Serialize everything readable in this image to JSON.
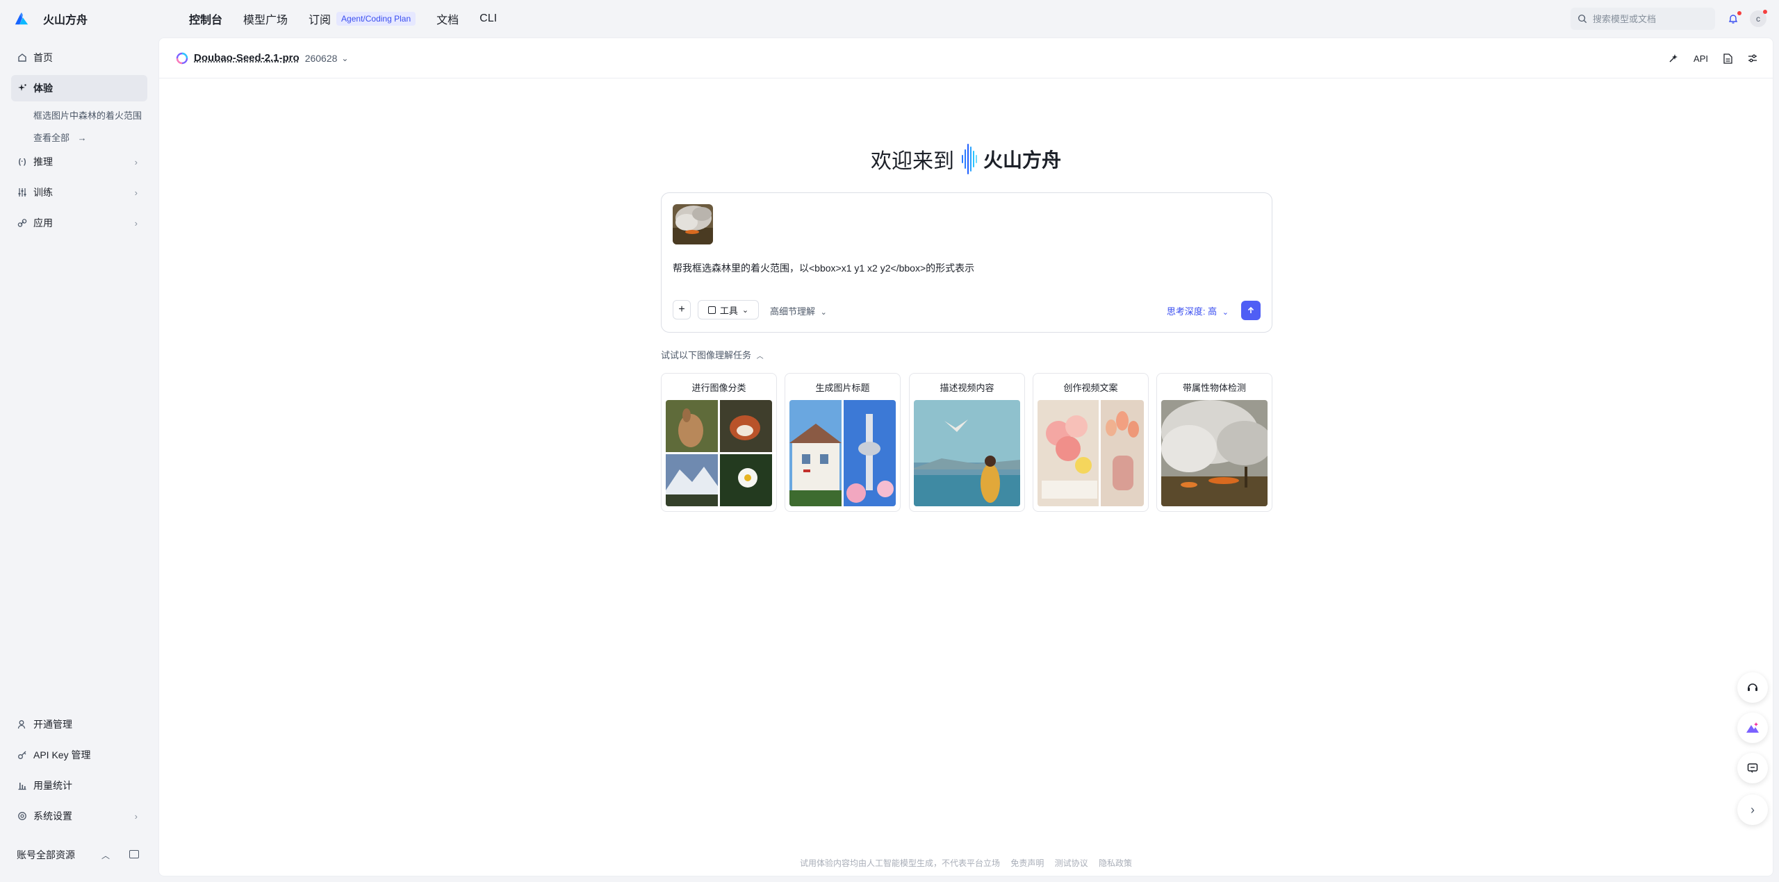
{
  "brand": {
    "name": "火山方舟"
  },
  "topnav": [
    {
      "label": "控制台"
    },
    {
      "label": "模型广场"
    },
    {
      "label": "订阅",
      "badge": "Agent/Coding Plan"
    },
    {
      "label": "文档"
    },
    {
      "label": "CLI"
    }
  ],
  "search": {
    "placeholder": "搜索模型或文档"
  },
  "user": {
    "avatar_letter": "c"
  },
  "sidebar": {
    "items": [
      {
        "label": "首页",
        "icon": "home-icon"
      },
      {
        "label": "体验",
        "icon": "sparkle-icon"
      },
      {
        "label": "推理",
        "icon": "brackets-icon"
      },
      {
        "label": "训练",
        "icon": "sliders-icon"
      },
      {
        "label": "应用",
        "icon": "link-icon"
      }
    ],
    "sub": {
      "recent": "框选图片中森林的着火范围",
      "view_all": "查看全部"
    },
    "bottom": [
      {
        "label": "开通管理",
        "icon": "user-icon"
      },
      {
        "label": "API Key 管理",
        "icon": "key-icon"
      },
      {
        "label": "用量统计",
        "icon": "bar-chart-icon"
      },
      {
        "label": "系统设置",
        "icon": "settings-icon"
      }
    ],
    "account": "账号全部资源"
  },
  "model": {
    "name": "Doubao-Seed-2.1-pro",
    "version": "260628",
    "api_label": "API"
  },
  "welcome": {
    "prefix": "欢迎来到",
    "brand": "火山方舟"
  },
  "composer": {
    "prompt": "帮我框选森林里的着火范围，以<bbox>x1 y1 x2 y2</bbox>的形式表示",
    "tools_label": "工具",
    "detail_label": "高细节理解",
    "depth_label": "思考深度: 高"
  },
  "try": {
    "label": "试试以下图像理解任务"
  },
  "cards": [
    {
      "title": "进行图像分类"
    },
    {
      "title": "生成图片标题"
    },
    {
      "title": "描述视频内容"
    },
    {
      "title": "创作视频文案"
    },
    {
      "title": "带属性物体检测"
    }
  ],
  "footer": {
    "disclaimer": "试用体验内容均由人工智能模型生成，不代表平台立场",
    "terms": "免责声明",
    "agreement": "测试协议",
    "privacy": "隐私政策"
  },
  "colors": {
    "accent": "#4f5ef5",
    "badge_bg": "#e6e8ff"
  }
}
